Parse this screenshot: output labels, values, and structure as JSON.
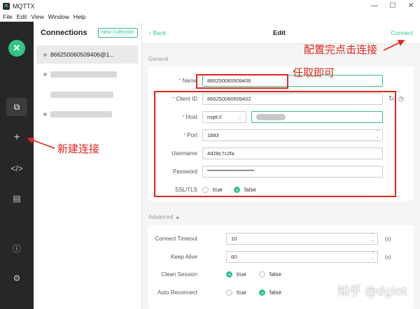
{
  "window": {
    "title": "MQTTX",
    "minimize": "—",
    "maximize": "☐",
    "close": "✕"
  },
  "menu": [
    "File",
    "Edit",
    "View",
    "Window",
    "Help"
  ],
  "sidebar": {
    "brand": "✕",
    "icons": [
      "copy-icon",
      "plus-icon",
      "code-icon",
      "log-icon",
      "info-icon",
      "gear-icon"
    ]
  },
  "connections": {
    "header": "Connections",
    "new_collection": "New Collection",
    "items": [
      {
        "name": "866250060509406@1..."
      }
    ]
  },
  "topbar": {
    "back": "Back",
    "title": "Edit",
    "connect": "Connect"
  },
  "general": {
    "section": "General",
    "name_label": "Name",
    "name_value": "866250060509406",
    "client_id_label": "Client ID",
    "client_id_value": "866250060509402",
    "host_label": "Host",
    "host_protocol": "mqtt://",
    "port_label": "Port",
    "port_value": "1883",
    "username_label": "Username",
    "username_value": "4d28c7c2fa",
    "password_label": "Password",
    "password_value": "••••••••••••••••••••••••••••••••",
    "ssl_label": "SSL/TLS",
    "ssl_true": "true",
    "ssl_false": "false"
  },
  "advanced": {
    "section": "Advanced ▲",
    "connect_timeout_label": "Connect Timeout",
    "connect_timeout_value": "10",
    "keep_alive_label": "Keep Alive",
    "keep_alive_value": "60",
    "unit": "(s)",
    "clean_session_label": "Clean Session",
    "auto_reconnect_label": "Auto Reconnect",
    "opt_true": "true",
    "opt_false": "false"
  },
  "annotations": {
    "connect_note": "配置完点击连接",
    "name_note": "任取即可",
    "new_note": "新建连接"
  },
  "watermark": "知乎 @dgiot"
}
